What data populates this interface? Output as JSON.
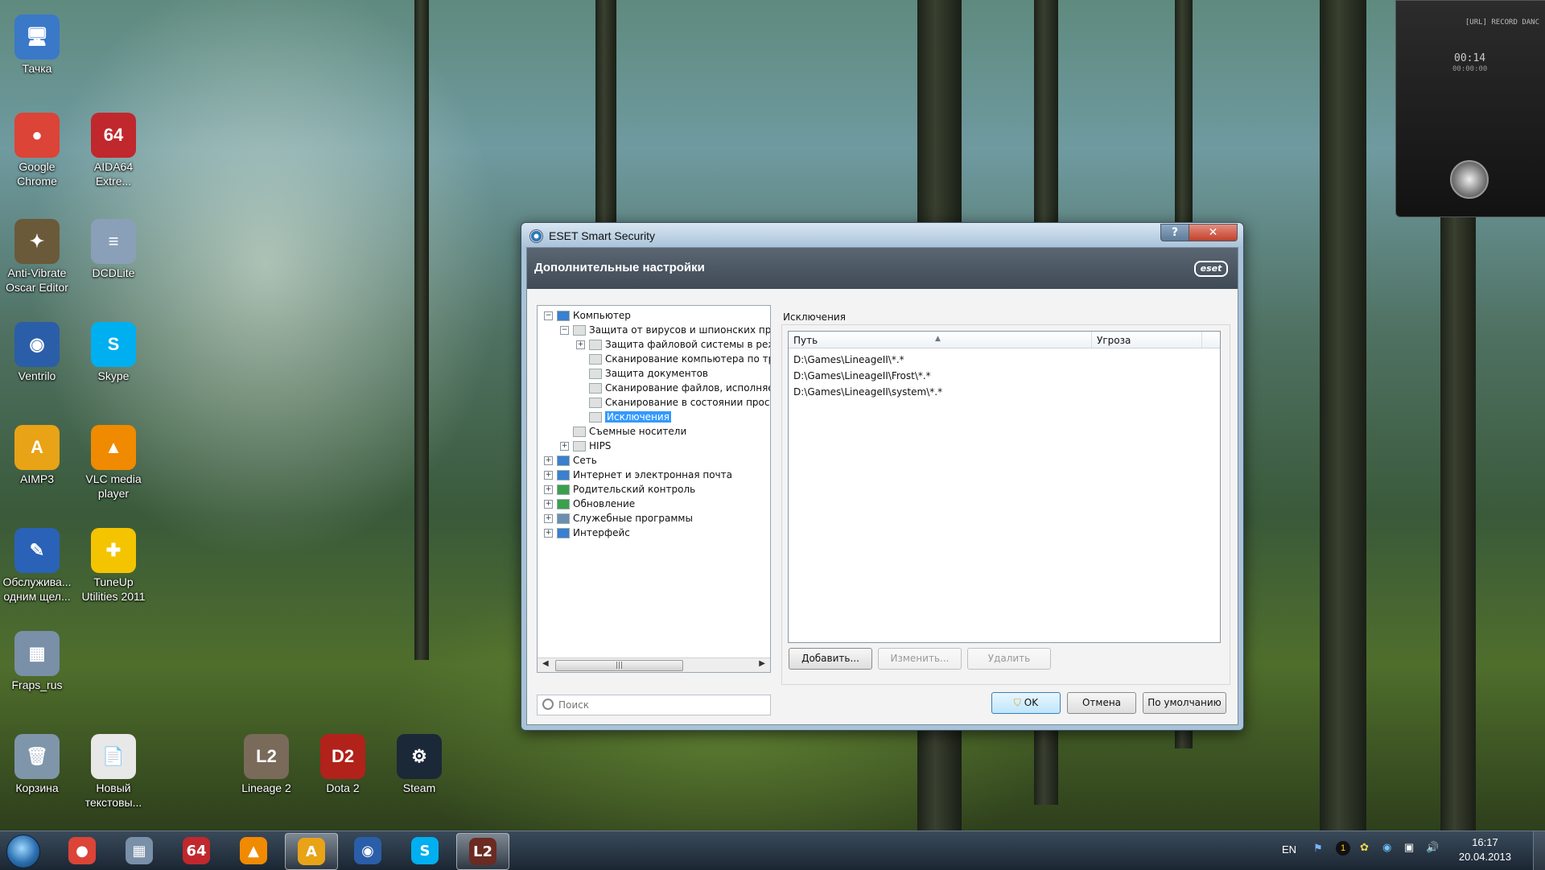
{
  "desktop": {
    "icons": [
      {
        "label": "Тачка",
        "color": "#3a78c8",
        "glyph": "🖥"
      },
      {
        "label": "Google Chrome",
        "color": "#db4437",
        "glyph": "●"
      },
      {
        "label": "AIDA64 Extre...",
        "color": "#c0282d",
        "glyph": "64"
      },
      {
        "label": "Anti-Vibrate Oscar Editor",
        "color": "#6a5a3a",
        "glyph": "✦"
      },
      {
        "label": "DCDLite",
        "color": "#8aa0b8",
        "glyph": "≡"
      },
      {
        "label": "Ventrilo",
        "color": "#2a5ea8",
        "glyph": "◉"
      },
      {
        "label": "Skype",
        "color": "#00aff0",
        "glyph": "S"
      },
      {
        "label": "AIMP3",
        "color": "#e8a317",
        "glyph": "A"
      },
      {
        "label": "VLC media player",
        "color": "#f08a00",
        "glyph": "▲"
      },
      {
        "label": "Обслужива... одним щел...",
        "color": "#2a62b8",
        "glyph": "✎"
      },
      {
        "label": "TuneUp Utilities 2011",
        "color": "#f5c400",
        "glyph": "✚"
      },
      {
        "label": "Fraps_rus",
        "color": "#7a8fa8",
        "glyph": "▦"
      },
      {
        "label": "Корзина",
        "color": "#7f95aa",
        "glyph": "🗑"
      },
      {
        "label": "Новый текстовы...",
        "color": "#e8e8e8",
        "glyph": "📄"
      },
      {
        "label": "Lineage 2",
        "color": "#7a6a5a",
        "glyph": "L2"
      },
      {
        "label": "Dota 2",
        "color": "#b1221a",
        "glyph": "D2"
      },
      {
        "label": "Steam",
        "color": "#1b2838",
        "glyph": "⚙"
      }
    ]
  },
  "gadget": {
    "title": "[URL] RECORD DANC",
    "time": "00:14",
    "time_small": "00:00:00"
  },
  "window": {
    "title": "ESET Smart Security",
    "help_label": "?",
    "close_label": "✕",
    "header_title": "Дополнительные настройки",
    "logo_text": "eset",
    "tree": [
      {
        "label": "Компьютер",
        "exp": "−",
        "icon": "#3a7fd0"
      },
      {
        "label": "Защита от вирусов и шпионских прогр",
        "exp": "−",
        "icon": "#e0e0e0"
      },
      {
        "label": "Защита файловой системы в режи",
        "exp": "+",
        "icon": "#e0e0e0"
      },
      {
        "label": "Сканирование компьютера по тре",
        "exp": "",
        "icon": "#e0e0e0"
      },
      {
        "label": "Защита документов",
        "exp": "",
        "icon": "#e0e0e0"
      },
      {
        "label": "Сканирование файлов, исполняем",
        "exp": "",
        "icon": "#e0e0e0"
      },
      {
        "label": "Сканирование в состоянии просто",
        "exp": "",
        "icon": "#e0e0e0"
      },
      {
        "label": "Исключения",
        "exp": "",
        "icon": "#e0e0e0",
        "selected": true
      },
      {
        "label": "Съемные носители",
        "exp": "",
        "icon": "#e0e0e0"
      },
      {
        "label": "HIPS",
        "exp": "+",
        "icon": "#e0e0e0"
      },
      {
        "label": "Сеть",
        "exp": "+",
        "icon": "#3a7fd0"
      },
      {
        "label": "Интернет и электронная почта",
        "exp": "+",
        "icon": "#3a7fd0"
      },
      {
        "label": "Родительский контроль",
        "exp": "+",
        "icon": "#3aa04a"
      },
      {
        "label": "Обновление",
        "exp": "+",
        "icon": "#3aa04a"
      },
      {
        "label": "Служебные программы",
        "exp": "+",
        "icon": "#6a8fb0"
      },
      {
        "label": "Интерфейс",
        "exp": "+",
        "icon": "#3a7fd0"
      }
    ],
    "scroll_thumb": "|||",
    "search_placeholder": "Поиск",
    "section_label": "Исключения",
    "columns": [
      "Путь",
      "Угроза"
    ],
    "rows": [
      "D:\\Games\\LineageII\\*.*",
      "D:\\Games\\LineageII\\Frost\\*.*",
      "D:\\Games\\LineageII\\system\\*.*"
    ],
    "buttons": {
      "add": "Добавить...",
      "edit": "Изменить...",
      "delete": "Удалить",
      "ok": "OK",
      "cancel": "Отмена",
      "default": "По умолчанию"
    }
  },
  "taskbar": {
    "items": [
      {
        "name": "chrome",
        "color": "#db4437",
        "glyph": "●"
      },
      {
        "name": "fraps",
        "color": "#7a8fa8",
        "glyph": "▦"
      },
      {
        "name": "aida64",
        "color": "#c0282d",
        "glyph": "64"
      },
      {
        "name": "vlc",
        "color": "#f08a00",
        "glyph": "▲"
      },
      {
        "name": "aimp",
        "color": "#e8a317",
        "glyph": "A",
        "active": true
      },
      {
        "name": "ventrilo",
        "color": "#2a5ea8",
        "glyph": "◉"
      },
      {
        "name": "skype",
        "color": "#00aff0",
        "glyph": "S"
      },
      {
        "name": "lineage",
        "color": "#6b2a22",
        "glyph": "L2",
        "active": true
      }
    ],
    "lang": "EN",
    "time": "16:17",
    "date": "20.04.2013"
  }
}
